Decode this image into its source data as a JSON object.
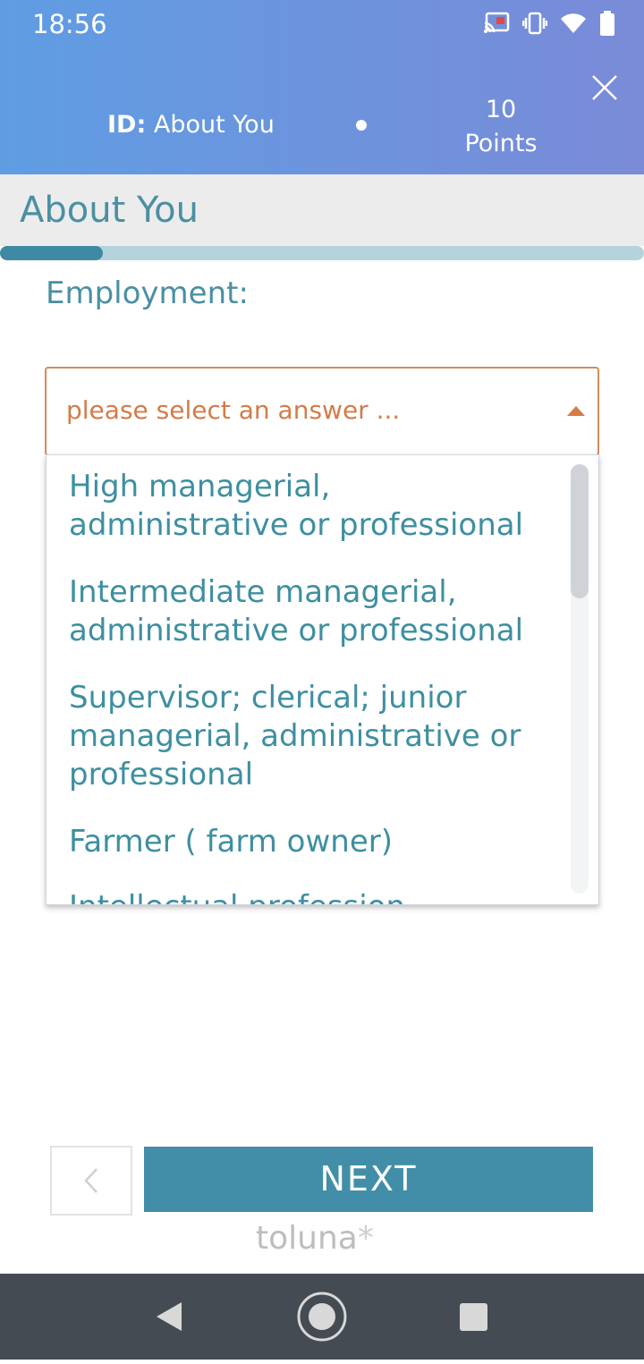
{
  "status_bar": {
    "time": "18:56",
    "icons": [
      "cast-icon",
      "vibrate-icon",
      "wifi-icon",
      "battery-icon"
    ]
  },
  "header": {
    "id_prefix": "ID:",
    "id_value": "About You",
    "points_value": "10",
    "points_label": "Points"
  },
  "section": {
    "title": "About You",
    "progress_percent": 16
  },
  "question": {
    "label": "Employment:",
    "placeholder": "please select an answer ..."
  },
  "options": [
    "High managerial, administrative or professional",
    "Intermediate managerial, administrative or professional",
    "Supervisor; clerical; junior managerial, administrative or professional",
    "Farmer ( farm owner)",
    "Intellectual profession"
  ],
  "footer": {
    "next_label": "NEXT",
    "brand": "toluna"
  },
  "colors": {
    "header_start": "#5f9de3",
    "header_end": "#7a8bd8",
    "accent": "#428ea8",
    "text_teal": "#3e8fa1",
    "placeholder_orange": "#d47b48"
  }
}
